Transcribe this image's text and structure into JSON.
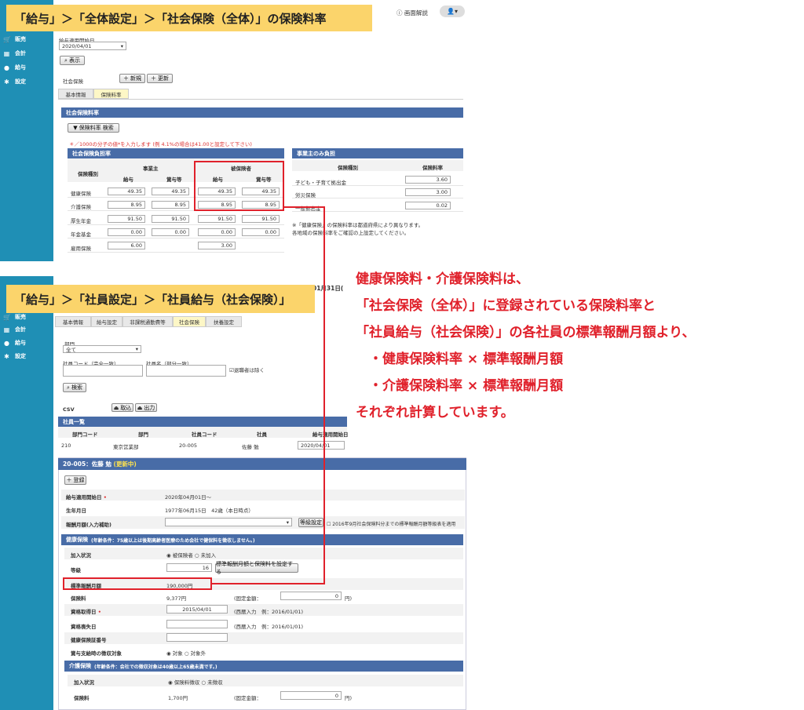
{
  "callout1": "「給与」＞「全体設定」＞「社会保険（全体）」の保険料率",
  "callout2": "「給与」＞「社員設定」＞「社員給与（社会保険）」",
  "header": {
    "help_label": "画面解説",
    "user_label": "▾"
  },
  "sidebar": {
    "items": [
      "販売",
      "会計",
      "給与",
      "設定"
    ]
  },
  "s1": {
    "start_label": "給与適用開始日",
    "start_value": "2020/04/01",
    "show_button": "表示",
    "shaho_label": "社会保険",
    "new_button": "新規",
    "update_button": "更新",
    "tabs": [
      "基本情報",
      "保険料率"
    ],
    "section_title": "社会保険料率",
    "search_button": "保険料率 検索",
    "hint": "＊／1000の分子の値*を入力します (例 4.1%の場合は41.00と設定して下さい)",
    "burden_title": "社会保険負担率",
    "col_type": "保険種別",
    "col_employer": "事業主",
    "col_insured": "被保険者",
    "col_pay": "給与",
    "col_bonus": "賞与等",
    "rows": [
      {
        "name": "健康保険",
        "v": [
          "49.35",
          "49.35",
          "49.35",
          "49.35"
        ]
      },
      {
        "name": "介護保険",
        "v": [
          "8.95",
          "8.95",
          "8.95",
          "8.95"
        ]
      },
      {
        "name": "厚生年金",
        "v": [
          "91.50",
          "91.50",
          "91.50",
          "91.50"
        ]
      },
      {
        "name": "年金基金",
        "v": [
          "0.00",
          "0.00",
          "0.00",
          "0.00"
        ]
      },
      {
        "name": "雇用保険",
        "v": [
          "6.00",
          "",
          "3.00",
          ""
        ]
      }
    ],
    "employer_only_title": "事業主のみ負担",
    "eo_col_type": "保険種別",
    "eo_col_rate": "保険料率",
    "eo_rows": [
      {
        "name": "子ども・子育て拠出金",
        "v": "3.60"
      },
      {
        "name": "労災保険",
        "v": "3.00"
      },
      {
        "name": "一般拠出金",
        "v": "0.02"
      }
    ],
    "remark1": "※「健康保険」の保険料率は都道府県により異なります。",
    "remark2": "各地域の保険料率をご確認の上設定してください。"
  },
  "s2": {
    "date_fragment": "01月31日(",
    "tabs": [
      "基本情報",
      "給与設定",
      "非課税通勤費等",
      "社会保険",
      "扶養設定"
    ],
    "dept_label": "部門",
    "dept_value": "全て",
    "code_label": "社員コード（完全一致）",
    "name_label": "社員名（部分一致）",
    "retired_label": "退職者は除く",
    "search_button": "検索",
    "csv_label": "CSV",
    "import_button": "取込",
    "export_button": "出力",
    "list_title": "社員一覧",
    "list_headers": [
      "部門コード",
      "部門",
      "社員コード",
      "社員",
      "給与適用開始日"
    ],
    "list_row": [
      "210",
      "東京営業部",
      "20-005",
      "佐藤 勉",
      "2020/04/01"
    ],
    "detail_title": "20-005：佐藤 勉",
    "detail_status": "(更新中)",
    "register_button": "登録",
    "start_label": "給与適用開始日",
    "start_value": "2020年04月01日～",
    "birth_label": "生年月日",
    "birth_value": "1977年06月15日　42歳（本日時点）",
    "reward_label": "報酬月額(入力補助)",
    "grade_button": "等級設定",
    "grade_note": "2016年9月社会保険料分までの標準報酬月額等級表を適用",
    "health_title": "健康保険",
    "health_cond": "(年齢条件：75歳以上は後期高齢者医療のため会社で健保料を徴収しません。)",
    "join_label": "加入状況",
    "join_opt1": "被保険者",
    "join_opt2": "未加入",
    "grade_label": "等級",
    "grade_value": "16",
    "set_button": "標準報酬月額と保険料を設定する",
    "std_label": "標準報酬月額",
    "std_value": "190,000円",
    "premium_label": "保険料",
    "premium_value": "9,377円",
    "fixed_label": "(固定金額：",
    "fixed_value": "0",
    "yen_close": "円)",
    "acquire_label": "資格取得日",
    "acquire_value": "2015/04/01",
    "western_hint": "(西暦入力　例：2016/01/01)",
    "loss_label": "資格喪失日",
    "card_label": "健康保険証番号",
    "bonus_label": "賞与支給時の徴収対象",
    "target_opt1": "対象",
    "target_opt2": "対象外",
    "care_title": "介護保険",
    "care_cond": "(年齢条件：会社での徴収対象は40歳以上65歳未満です。)",
    "care_join_label": "加入状況",
    "care_opt1": "保険料徴収",
    "care_opt2": "未徴収",
    "care_premium_label": "保険料",
    "care_premium_value": "1,700円",
    "care_fixed_value": "0"
  },
  "note_lines": [
    "健康保険料・介護保険料は、",
    "「社会保険（全体）」に登録されている保険料率と",
    "「社員給与（社会保険）」の各社員の標準報酬月額より、",
    "　・健康保険料率 × 標準報酬月額",
    "　・介護保険料率 × 標準報酬月額",
    "それぞれ計算しています。"
  ],
  "colors": {
    "sidebar": "#1f8fb5",
    "section": "#486ca7",
    "callout": "#fbd46b",
    "highlight": "#e0212b",
    "note": "#e0212b"
  }
}
